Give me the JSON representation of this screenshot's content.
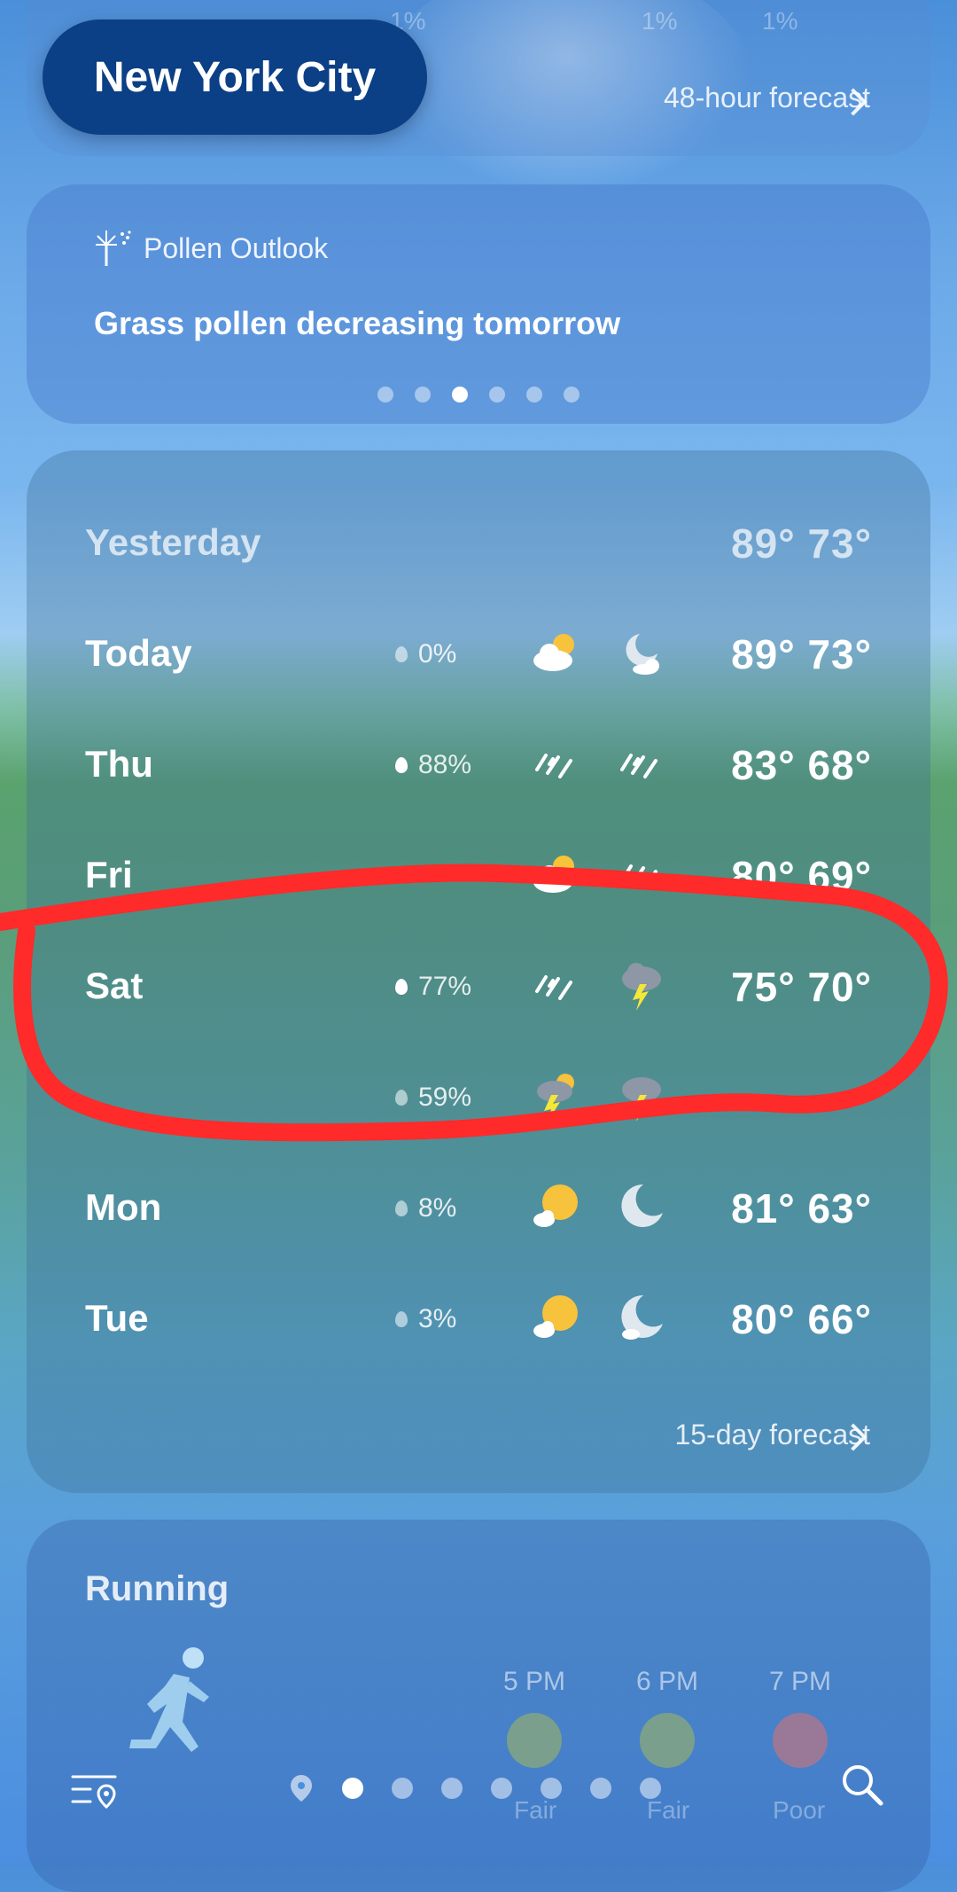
{
  "header": {
    "city": "New York City",
    "forecast_48h_label": "48-hour forecast",
    "faded_pcts": [
      "1%",
      "1%",
      "1%"
    ]
  },
  "pollen": {
    "title": "Pollen Outlook",
    "message": "Grass pollen decreasing tomorrow",
    "dots_count": 6,
    "active_dot": 2
  },
  "daily": {
    "rows": [
      {
        "day": "Yesterday",
        "precip": "",
        "icon_day": "",
        "icon_night": "",
        "high": "89°",
        "low": "73°"
      },
      {
        "day": "Today",
        "precip": "0%",
        "icon_day": "partly-cloudy-sun-icon",
        "icon_night": "partly-cloudy-moon-icon",
        "high": "89°",
        "low": "73°"
      },
      {
        "day": "Thu",
        "precip": "88%",
        "icon_day": "rain-icon",
        "icon_night": "rain-icon",
        "high": "83°",
        "low": "68°"
      },
      {
        "day": "Fri",
        "precip": "",
        "icon_day": "partly-cloudy-sun-icon",
        "icon_night": "rain-icon",
        "high": "80°",
        "low": "69°"
      },
      {
        "day": "Sat",
        "precip": "77%",
        "icon_day": "rain-icon",
        "icon_night": "thunderstorm-icon",
        "high": "75°",
        "low": "70°"
      },
      {
        "day": "",
        "precip": "59%",
        "icon_day": "thunderstorm-sun-icon",
        "icon_night": "thunderstorm-icon",
        "high": "",
        "low": ""
      },
      {
        "day": "Mon",
        "precip": "8%",
        "icon_day": "sunny-cloud-icon",
        "icon_night": "moon-icon",
        "high": "81°",
        "low": "63°"
      },
      {
        "day": "Tue",
        "precip": "3%",
        "icon_day": "sunny-cloud-icon",
        "icon_night": "moon-cloud-icon",
        "high": "80°",
        "low": "66°"
      }
    ],
    "forecast_15d_label": "15-day forecast"
  },
  "running": {
    "title": "Running",
    "times": [
      "5 PM",
      "6 PM",
      "7 PM"
    ],
    "labels": [
      "Fair",
      "Fair",
      "Poor"
    ]
  },
  "nav": {
    "page_dots": 7,
    "active_page": 0
  },
  "colors": {
    "city_pill": "#0b3f86",
    "annotation": "#ff2a2a",
    "sun": "#f7c23c",
    "bolt": "#f5e63a"
  }
}
